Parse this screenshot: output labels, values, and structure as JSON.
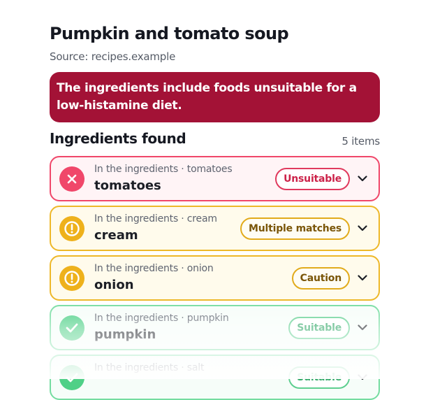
{
  "recipe": {
    "title": "Pumpkin and tomato soup",
    "source": "Source: recipes.example"
  },
  "alert": {
    "text": "The ingredients include foods unsuitable for a low-histamine diet.",
    "color": "#a31236"
  },
  "ingredients_section": {
    "title": "Ingredients found",
    "count": "5 items"
  },
  "ingredients": [
    {
      "context": "In the ingredients · tomatoes",
      "name": "tomatoes",
      "status": "Unsuitable",
      "status_icon": "x-icon"
    },
    {
      "context": "In the ingredients · cream",
      "name": "cream",
      "status": "Multiple matches",
      "status_icon": "exclamation-icon"
    },
    {
      "context": "In the ingredients · onion",
      "name": "onion",
      "status": "Caution",
      "status_icon": "exclamation-icon"
    },
    {
      "context": "In the ingredients · pumpkin",
      "name": "pumpkin",
      "status": "Suitable",
      "status_icon": "check-icon"
    },
    {
      "context": "In the ingredients · salt",
      "name": "",
      "status": "Suitable",
      "status_icon": "check-icon"
    }
  ],
  "colors": {
    "unsuitable": "#f0476a",
    "caution": "#eeb829",
    "suitable": "#74dca0"
  }
}
